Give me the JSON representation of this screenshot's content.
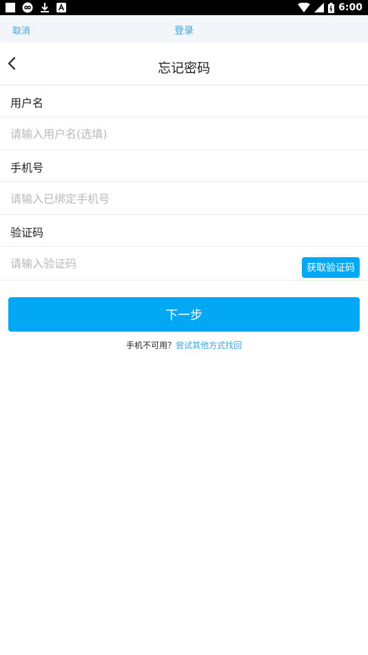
{
  "status_bar": {
    "time": "6:00",
    "icons_left": [
      "square-icon",
      "infinity-icon",
      "download-icon",
      "a-icon"
    ],
    "icons_right": [
      "wifi-icon",
      "signal-icon",
      "battery-icon"
    ]
  },
  "top_bar": {
    "cancel_label": "取消",
    "login_label": "登录"
  },
  "header": {
    "title": "忘记密码",
    "back_icon": "chevron-left-icon"
  },
  "form": {
    "username_label": "用户名",
    "username_placeholder": "请输入用户名(选填)",
    "username_value": "",
    "phone_label": "手机号",
    "phone_placeholder": "请输入已绑定手机号",
    "phone_value": "",
    "code_label": "验证码",
    "code_placeholder": "请输入验证码",
    "code_value": "",
    "get_code_label": "获取验证码"
  },
  "next_label": "下一步",
  "alt": {
    "prefix": "手机不可用？",
    "link": "尝试其他方式找回"
  },
  "colors": {
    "accent": "#02a8f3",
    "link": "#3aa5e0",
    "top_bar_bg": "#f2f5f9"
  }
}
